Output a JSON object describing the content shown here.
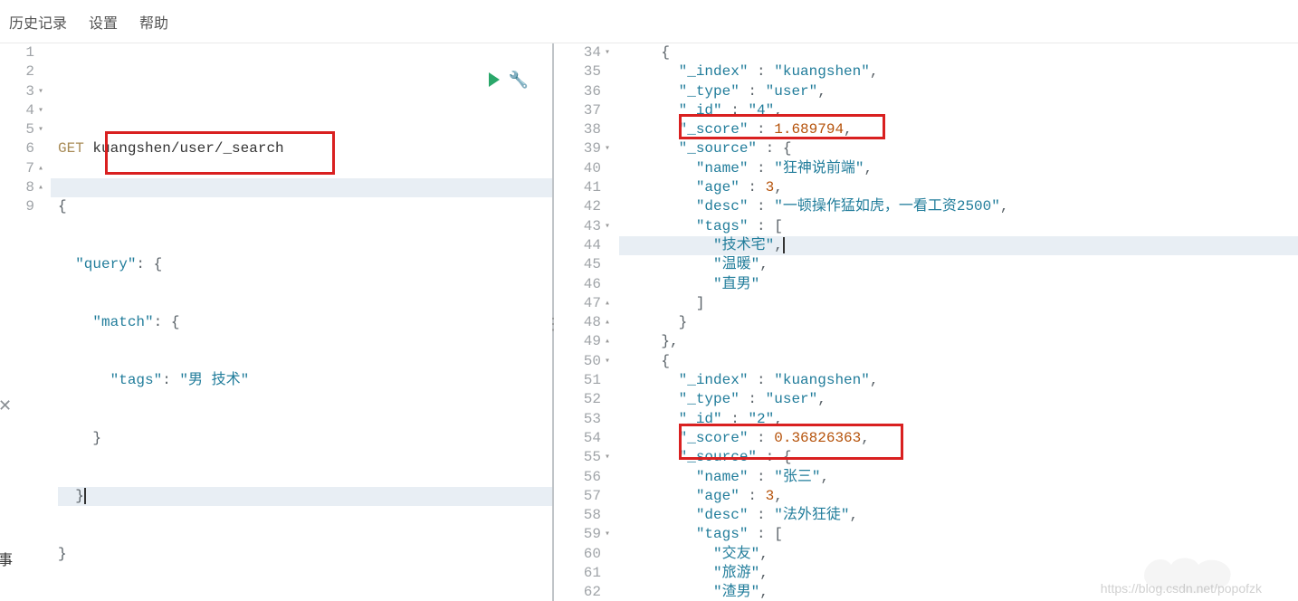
{
  "toolbar": {
    "history": "历史记录",
    "settings": "设置",
    "help": "帮助"
  },
  "left": {
    "lines": [
      "1",
      "2",
      "3",
      "4",
      "5",
      "6",
      "7",
      "8",
      "9"
    ],
    "folds": {
      "3": "▾",
      "4": "▾",
      "5": "▾",
      "7": "▴",
      "8": "▴"
    },
    "method": "GET",
    "path": "kuangshen/user/_search",
    "q_open": "{",
    "query_lbl": "\"query\"",
    "query_after": ": {",
    "match_lbl": "\"match\"",
    "match_after": ": {",
    "tags_lbl": "\"tags\"",
    "tags_colon": ": ",
    "tags_val": "\"男 技术\"",
    "close_inner": "}",
    "close_match": "}",
    "close_root": "}"
  },
  "right": {
    "start": 34,
    "lines": [
      "34",
      "35",
      "36",
      "37",
      "38",
      "39",
      "40",
      "41",
      "42",
      "43",
      "44",
      "45",
      "46",
      "47",
      "48",
      "49",
      "50",
      "51",
      "52",
      "53",
      "54",
      "55",
      "56",
      "57",
      "58",
      "59",
      "60",
      "61",
      "62"
    ],
    "folds": {
      "34": "▾",
      "39": "▾",
      "43": "▾",
      "47": "▴",
      "48": "▴",
      "49": "▴",
      "50": "▾",
      "55": "▾",
      "59": "▾"
    },
    "rows": [
      {
        "i": 34,
        "indent": 2,
        "pre": "{"
      },
      {
        "i": 35,
        "indent": 3,
        "k": "\"_index\"",
        "sep": " : ",
        "v": "\"kuangshen\"",
        "tail": ","
      },
      {
        "i": 36,
        "indent": 3,
        "k": "\"_type\"",
        "sep": " : ",
        "v": "\"user\"",
        "tail": ","
      },
      {
        "i": 37,
        "indent": 3,
        "k": "\"_id\"",
        "sep": " : ",
        "v": "\"4\"",
        "tail": ","
      },
      {
        "i": 38,
        "indent": 3,
        "k": "\"_score\"",
        "sep": " : ",
        "num": "1.689794",
        "tail": ","
      },
      {
        "i": 39,
        "indent": 3,
        "k": "\"_source\"",
        "sep": " : ",
        "pre2": "{"
      },
      {
        "i": 40,
        "indent": 4,
        "k": "\"name\"",
        "sep": " : ",
        "v": "\"狂神说前端\"",
        "tail": ","
      },
      {
        "i": 41,
        "indent": 4,
        "k": "\"age\"",
        "sep": " : ",
        "num": "3",
        "tail": ","
      },
      {
        "i": 42,
        "indent": 4,
        "k": "\"desc\"",
        "sep": " : ",
        "v": "\"一顿操作猛如虎，一看工资2500\"",
        "tail": ","
      },
      {
        "i": 43,
        "indent": 4,
        "k": "\"tags\"",
        "sep": " : ",
        "pre2": "["
      },
      {
        "i": 44,
        "indent": 5,
        "v": "\"技术宅\"",
        "tail": ",",
        "cursor": true
      },
      {
        "i": 45,
        "indent": 5,
        "v": "\"温暖\"",
        "tail": ","
      },
      {
        "i": 46,
        "indent": 5,
        "v": "\"直男\""
      },
      {
        "i": 47,
        "indent": 4,
        "pre": "]"
      },
      {
        "i": 48,
        "indent": 3,
        "pre": "}"
      },
      {
        "i": 49,
        "indent": 2,
        "pre": "},"
      },
      {
        "i": 50,
        "indent": 2,
        "pre": "{"
      },
      {
        "i": 51,
        "indent": 3,
        "k": "\"_index\"",
        "sep": " : ",
        "v": "\"kuangshen\"",
        "tail": ","
      },
      {
        "i": 52,
        "indent": 3,
        "k": "\"_type\"",
        "sep": " : ",
        "v": "\"user\"",
        "tail": ","
      },
      {
        "i": 53,
        "indent": 3,
        "k": "\"_id\"",
        "sep": " : ",
        "v": "\"2\"",
        "tail": ","
      },
      {
        "i": 54,
        "indent": 3,
        "k": "\"_score\"",
        "sep": " : ",
        "num": "0.36826363",
        "tail": ","
      },
      {
        "i": 55,
        "indent": 3,
        "k": "\"_source\"",
        "sep": " : ",
        "pre2": "{"
      },
      {
        "i": 56,
        "indent": 4,
        "k": "\"name\"",
        "sep": " : ",
        "v": "\"张三\"",
        "tail": ","
      },
      {
        "i": 57,
        "indent": 4,
        "k": "\"age\"",
        "sep": " : ",
        "num": "3",
        "tail": ","
      },
      {
        "i": 58,
        "indent": 4,
        "k": "\"desc\"",
        "sep": " : ",
        "v": "\"法外狂徒\"",
        "tail": ","
      },
      {
        "i": 59,
        "indent": 4,
        "k": "\"tags\"",
        "sep": " : ",
        "pre2": "["
      },
      {
        "i": 60,
        "indent": 5,
        "v": "\"交友\"",
        "tail": ","
      },
      {
        "i": 61,
        "indent": 5,
        "v": "\"旅游\"",
        "tail": ","
      },
      {
        "i": 62,
        "indent": 5,
        "v": "\"渣男\"",
        "tail": ","
      }
    ]
  },
  "watermark": "https://blog.csdn.net/popofzk"
}
